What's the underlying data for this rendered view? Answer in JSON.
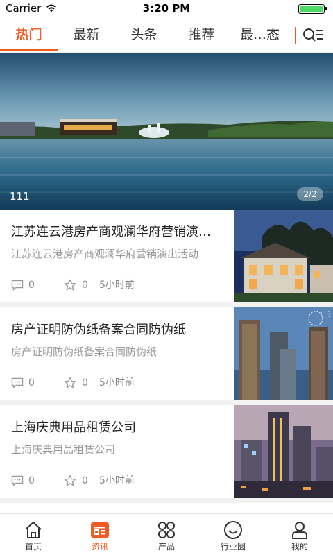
{
  "status_bar": {
    "carrier": "Carrier",
    "time": "3:20 PM"
  },
  "tabs": [
    {
      "label": "热门",
      "active": true
    },
    {
      "label": "最新",
      "active": false
    },
    {
      "label": "头条",
      "active": false
    },
    {
      "label": "推荐",
      "active": false
    },
    {
      "label": "最…态",
      "active": false
    }
  ],
  "tab_more_icon": "search-list-icon",
  "banner": {
    "caption": "111",
    "pager": "2/2"
  },
  "news": [
    {
      "title": "江苏连云港房产商观澜华府营销演出活动",
      "summary": "江苏连云港房产商观澜华府营销演出活动",
      "comments": "0",
      "likes": "0",
      "time": "5小时前"
    },
    {
      "title": "房产证明防伪纸备案合同防伪纸",
      "summary": "房产证明防伪纸备案合同防伪纸",
      "comments": "0",
      "likes": "0",
      "time": "5小时前"
    },
    {
      "title": "上海庆典用品租赁公司",
      "summary": "上海庆典用品租赁公司",
      "comments": "0",
      "likes": "0",
      "time": "5小时前"
    }
  ],
  "bottom_nav": [
    {
      "label": "首页",
      "icon": "home-icon",
      "active": false
    },
    {
      "label": "资讯",
      "icon": "news-icon",
      "active": true
    },
    {
      "label": "产品",
      "icon": "products-icon",
      "active": false
    },
    {
      "label": "行业圈",
      "icon": "community-icon",
      "active": false
    },
    {
      "label": "我的",
      "icon": "profile-icon",
      "active": false
    }
  ],
  "colors": {
    "accent": "#f15a22",
    "battery": "#4cd964"
  }
}
